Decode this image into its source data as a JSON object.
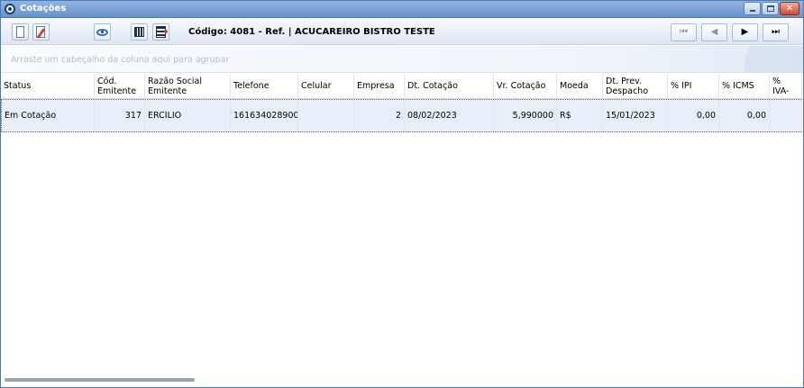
{
  "window": {
    "title": "Cotações",
    "minimize_icon": "minimize-icon",
    "maximize_icon": "maximize-icon",
    "close_glyph": "✕"
  },
  "toolbar": {
    "code_label": "Código: 4081 - Ref.  |  ACUCAREIRO BISTRO TESTE",
    "icons": [
      "new-document-icon",
      "edit-document-icon",
      "view-eye-icon",
      "grid-view-icon",
      "columns-config-icon"
    ],
    "nav": {
      "first": "⏮",
      "prev": "◀",
      "next": "▶",
      "last": "⏭"
    }
  },
  "group_panel": {
    "hint": "Arraste um cabeçalho da coluna aqui para agrupar"
  },
  "grid": {
    "columns": [
      "Status",
      "Cód. Emitente",
      "Razão Social Emitente",
      "Telefone",
      "Celular",
      "Empresa",
      "Dt. Cotação",
      "Vr. Cotação",
      "Moeda",
      "Dt. Prev. Despacho",
      "% IPI",
      "% ICMS",
      "% IVA-"
    ],
    "rows": [
      [
        "Em Cotação",
        "317",
        "ERCILIO",
        "161634028900",
        "",
        "2",
        "08/02/2023",
        "5,990000",
        "R$",
        "15/01/2023",
        "0,00",
        "0,00",
        ""
      ]
    ]
  }
}
